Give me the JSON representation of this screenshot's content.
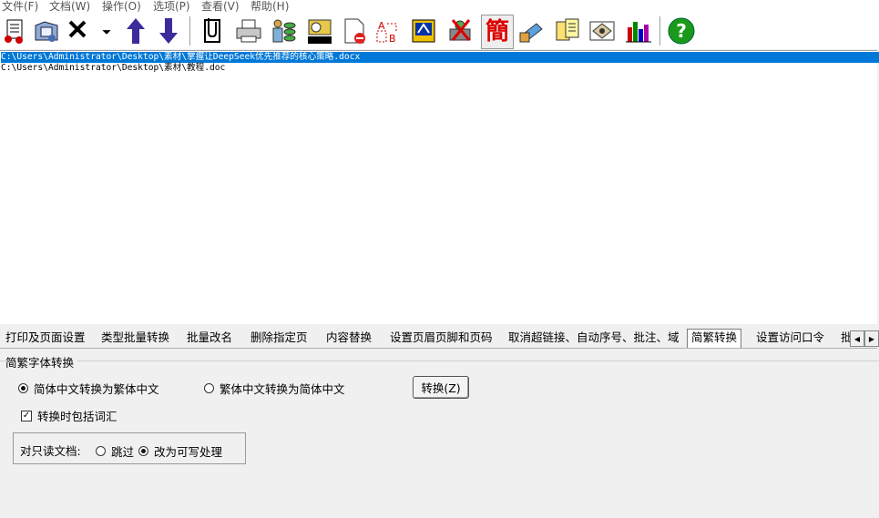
{
  "menu": [
    "文件(F)",
    "文档(W)",
    "操作(O)",
    "选项(P)",
    "查看(V)",
    "帮助(H)"
  ],
  "toolbar_icons": [
    "open-files-icon",
    "add-folder-icon",
    "delete-icon",
    "dropdown-arrow-icon",
    "move-up-icon",
    "move-down-icon",
    "clip-icon",
    "print-icon",
    "batch-convert-icon",
    "rename-icon",
    "delete-page-icon",
    "replace-text-icon",
    "header-footer-icon",
    "remove-links-icon",
    "simplified-traditional-icon",
    "password-icon",
    "document-props-icon",
    "settings-icon",
    "stats-icon",
    "help-icon"
  ],
  "toolbar_glyph_jian": "簡",
  "files": [
    {
      "path": "C:\\Users\\Administrator\\Desktop\\素材\\掌握让DeepSeek优先推荐的核心策略.docx",
      "selected": true
    },
    {
      "path": "C:\\Users\\Administrator\\Desktop\\素材\\教程.doc",
      "selected": false
    }
  ],
  "tabs": [
    "打印及页面设置",
    "类型批量转换",
    "批量改名",
    "删除指定页",
    "内容替换",
    "设置页眉页脚和页码",
    "取消超链接、自动序号、批注、域",
    "简繁转换",
    "设置访问口令",
    "批"
  ],
  "active_tab": "简繁转换",
  "panel": {
    "group_title": "简繁字体转换",
    "opt_s2t": "简体中文转换为繁体中文",
    "opt_t2s": "繁体中文转换为简体中文",
    "include_words": "转换时包括词汇",
    "convert_button": "转换(Z)",
    "readonly_label": "对只读文档:",
    "skip": "跳过",
    "make_writable": "改为可写处理"
  },
  "colors": {
    "selection": "#0078d7"
  }
}
